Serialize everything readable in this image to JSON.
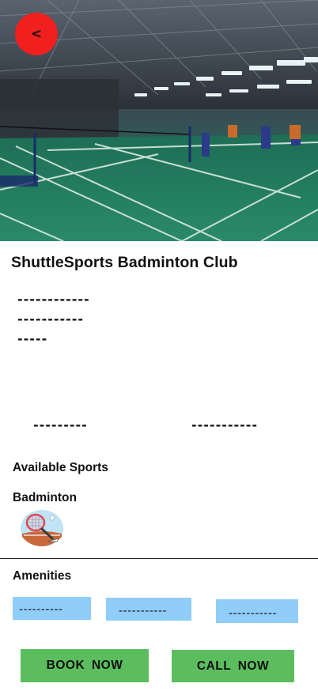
{
  "hero": {
    "image_alt": "Indoor badminton hall with green courts",
    "back_label": "<"
  },
  "club": {
    "name": "ShuttleSports Badminton Club",
    "description_lines": [
      "------------",
      "-----------",
      "-----"
    ],
    "info_left": "---------",
    "info_right": "-----------"
  },
  "sports": {
    "heading": "Available Sports",
    "items": [
      {
        "name": "Badminton",
        "icon": "badminton-racket-icon"
      }
    ]
  },
  "amenities": {
    "heading": "Amenities",
    "items": [
      "----------",
      "-----------",
      "-----------"
    ]
  },
  "actions": {
    "book_label": "BOOK  NOW",
    "call_label": "CALL  NOW"
  },
  "colors": {
    "back_button": "#f21f1f",
    "amenity_chip": "#90cdf9",
    "action_button": "#5cbd5e",
    "court_green": "#1f7a5c"
  }
}
